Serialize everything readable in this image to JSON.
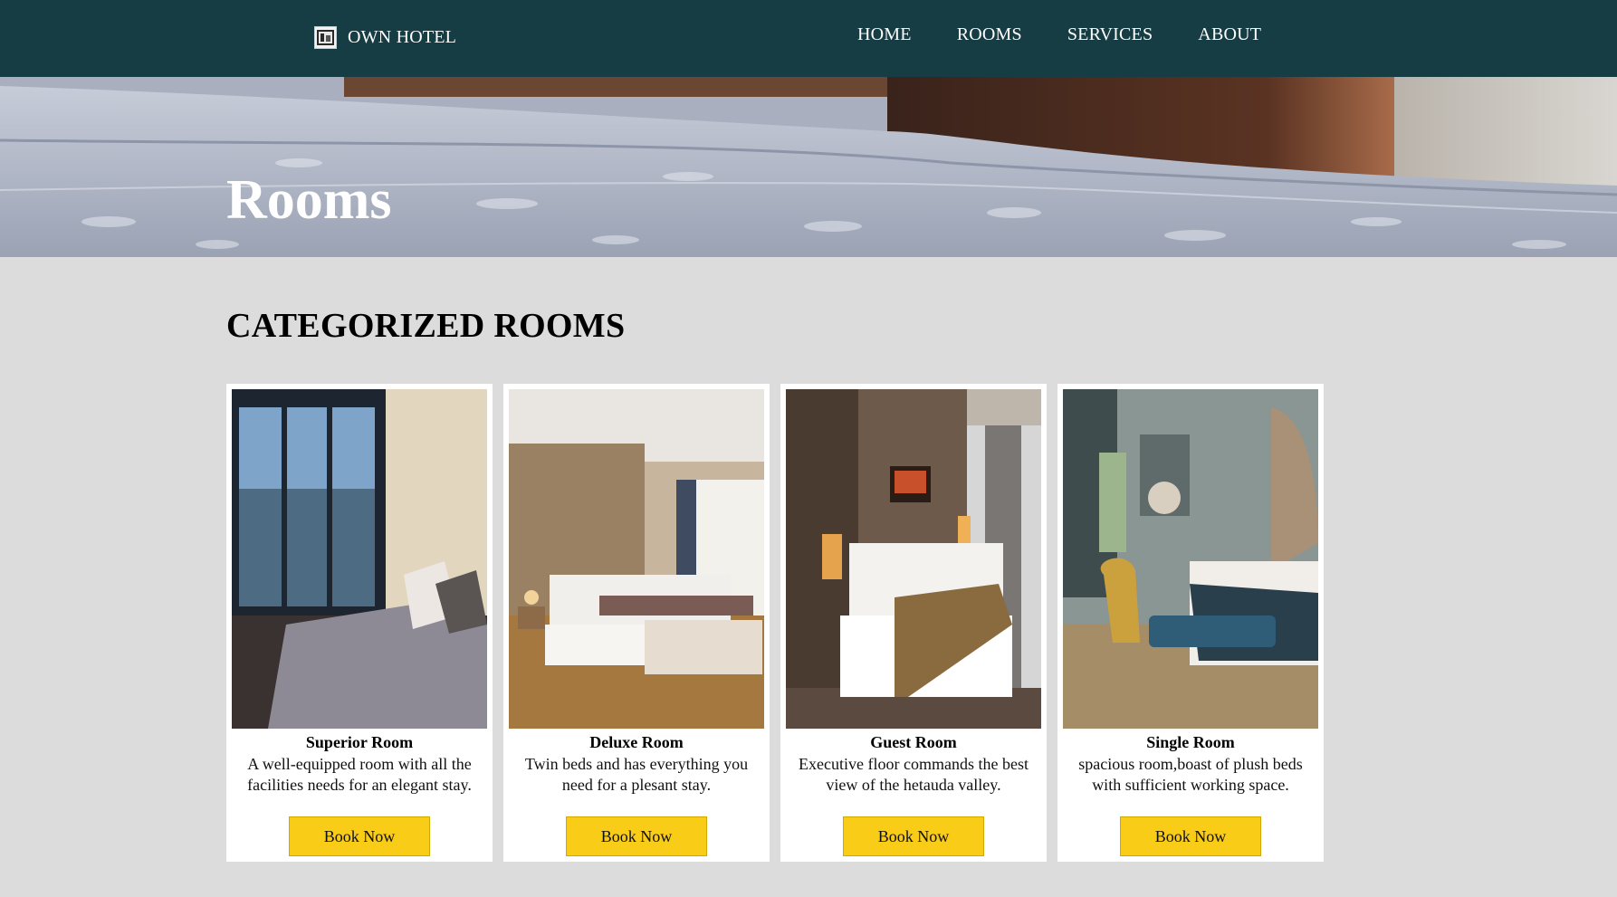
{
  "nav": {
    "logo_icon": "hotel-logo-icon",
    "brand": "OWN HOTEL",
    "links": [
      "HOME",
      "ROOMS",
      "SERVICES",
      "ABOUT"
    ]
  },
  "hero": {
    "title": "Rooms"
  },
  "section": {
    "title": "CATEGORIZED ROOMS"
  },
  "rooms": [
    {
      "name": "Superior Room",
      "description": "A well-equipped room with all the facilities needs for an elegant stay.",
      "button": "Book Now"
    },
    {
      "name": "Deluxe Room",
      "description": "Twin beds and has everything you need for a plesant stay.",
      "button": "Book Now"
    },
    {
      "name": "Guest Room",
      "description": "Executive floor commands the best view of the hetauda valley.",
      "button": "Book Now"
    },
    {
      "name": "Single Room",
      "description": "spacious room,boast of plush beds with sufficient working space.",
      "button": "Book Now"
    }
  ],
  "colors": {
    "navbar": "#173d44",
    "page_background": "#dcdcdc",
    "button": "#f9cc17"
  }
}
